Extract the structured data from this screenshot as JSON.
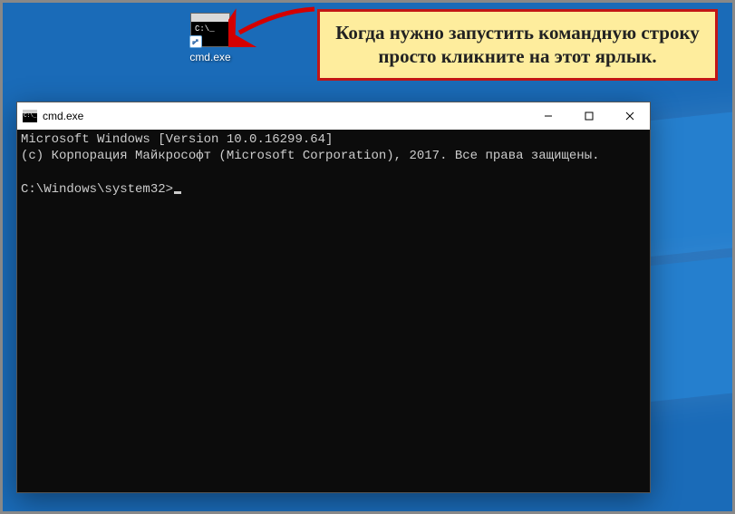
{
  "shortcut": {
    "label": "cmd.exe",
    "mini_prompt": "C:\\_"
  },
  "callout": {
    "text": "Когда нужно запустить командную строку просто кликните на этот ярлык."
  },
  "window": {
    "title": "cmd.exe"
  },
  "terminal": {
    "line1": "Microsoft Windows [Version 10.0.16299.64]",
    "line2": "(c) Корпорация Майкрософт (Microsoft Corporation), 2017. Все права защищены.",
    "blank": "",
    "prompt": "C:\\Windows\\system32>"
  }
}
